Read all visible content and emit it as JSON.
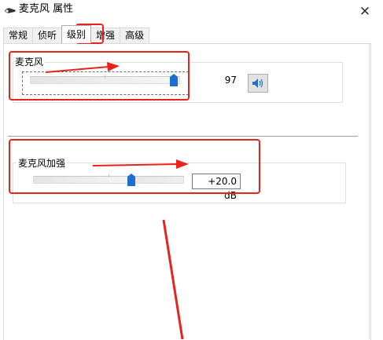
{
  "window": {
    "title": "麦克风 属性",
    "close_icon": "close-icon",
    "app_icon": "microphone-icon"
  },
  "tabs": [
    {
      "label": "常规",
      "active": false
    },
    {
      "label": "侦听",
      "active": false
    },
    {
      "label": "级别",
      "active": true
    },
    {
      "label": "增强",
      "active": false
    },
    {
      "label": "高级",
      "active": false
    }
  ],
  "microphone": {
    "label": "麦克风",
    "value": "97",
    "level_percent": 97,
    "speaker_icon": "speaker-icon"
  },
  "boost": {
    "label": "麦克风加强",
    "value": "+20.0 dB",
    "level_percent": 66
  },
  "colors": {
    "annotation": "#e8231e",
    "thumb": "#1b6fd1"
  }
}
